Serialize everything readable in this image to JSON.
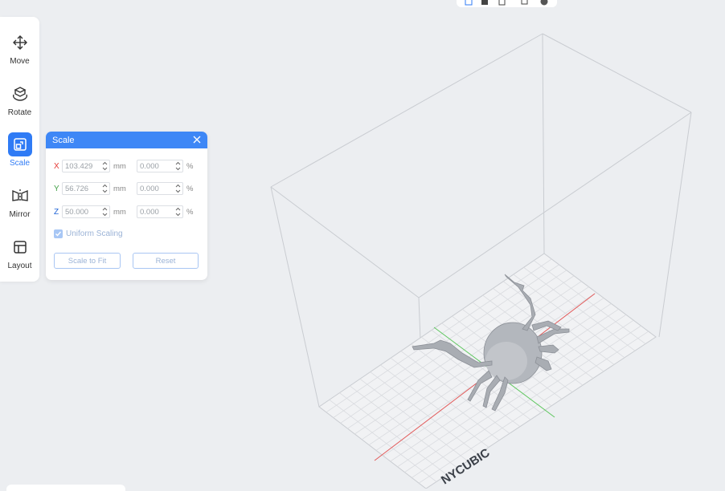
{
  "toolbar": {
    "items": [
      {
        "label": "Move",
        "icon": "move-icon"
      },
      {
        "label": "Rotate",
        "icon": "rotate-icon"
      },
      {
        "label": "Scale",
        "icon": "scale-icon",
        "active": true
      },
      {
        "label": "Mirror",
        "icon": "mirror-icon"
      },
      {
        "label": "Layout",
        "icon": "layout-icon"
      }
    ]
  },
  "scale_panel": {
    "title": "Scale",
    "rows": [
      {
        "axis": "X",
        "axis_color": "#e53935",
        "size": "103.429",
        "size_unit": "mm",
        "percent": "0.000",
        "percent_unit": "%"
      },
      {
        "axis": "Y",
        "axis_color": "#43a047",
        "size": "56.726",
        "size_unit": "mm",
        "percent": "0.000",
        "percent_unit": "%"
      },
      {
        "axis": "Z",
        "axis_color": "#1e63d6",
        "size": "50.000",
        "size_unit": "mm",
        "percent": "0.000",
        "percent_unit": "%"
      }
    ],
    "uniform_scaling_label": "Uniform Scaling",
    "uniform_scaling_checked": true,
    "scale_to_fit_label": "Scale to Fit",
    "reset_label": "Reset"
  },
  "viewport": {
    "plate_brand": "NYCUBIC",
    "model": "crab"
  },
  "colors": {
    "accent": "#2f7bf5",
    "panel_header": "#3e87f6",
    "background": "#eceef1"
  }
}
